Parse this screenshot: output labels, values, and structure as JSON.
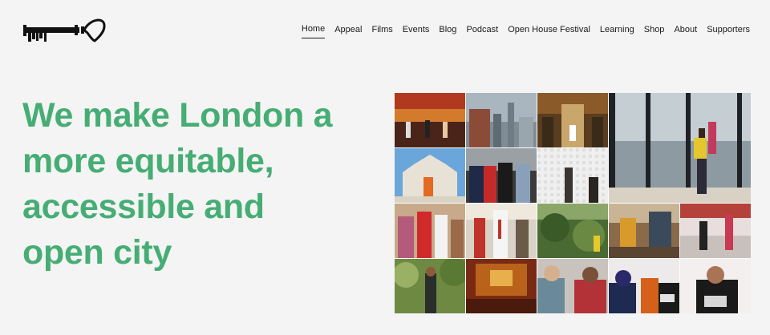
{
  "header": {
    "logo_icon": "key-heart-logo-icon",
    "nav": [
      {
        "label": "Home",
        "active": true
      },
      {
        "label": "Appeal",
        "active": false
      },
      {
        "label": "Films",
        "active": false
      },
      {
        "label": "Events",
        "active": false
      },
      {
        "label": "Blog",
        "active": false
      },
      {
        "label": "Podcast",
        "active": false
      },
      {
        "label": "Open House Festival",
        "active": false
      },
      {
        "label": "Learning",
        "active": false
      },
      {
        "label": "Shop",
        "active": false
      },
      {
        "label": "About",
        "active": false
      },
      {
        "label": "Supporters",
        "active": false
      }
    ]
  },
  "hero": {
    "line1": "We make London a",
    "line2": "more equitable,",
    "line3": "accessible and",
    "line4": "open city"
  },
  "colors": {
    "accent": "#46ad74",
    "background": "#f4f4f4",
    "text": "#1a1a1a"
  }
}
